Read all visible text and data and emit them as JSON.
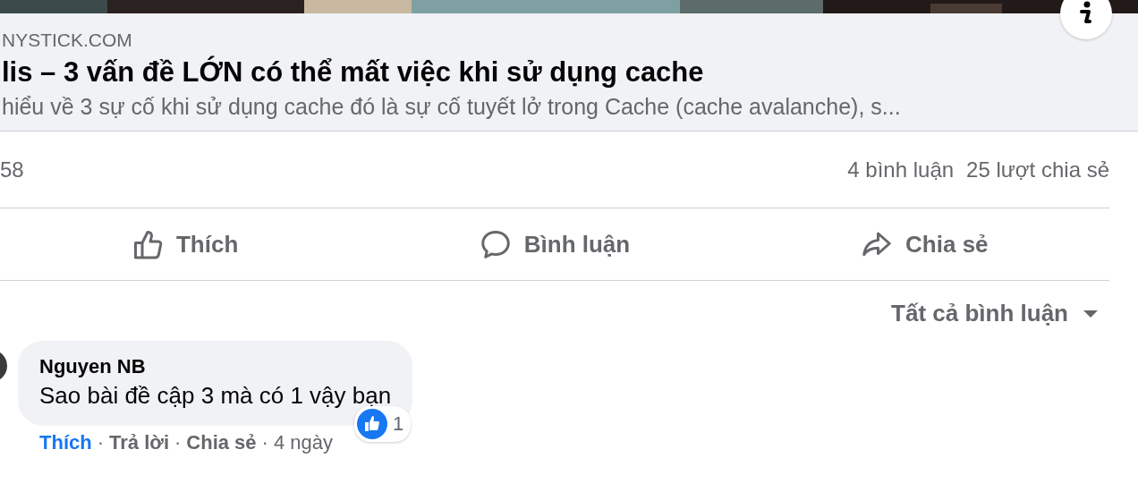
{
  "link_preview": {
    "domain": "NYSTICK.COM",
    "title": "lis – 3 vấn đề LỚN có thể mất việc khi sử dụng cache",
    "description": "hiểu về 3 sự cố khi sử dụng cache đó là sự cố tuyết lở trong Cache (cache avalanche), s..."
  },
  "stats": {
    "reactions": "58",
    "comments": "4 bình luận",
    "shares": "25 lượt chia sẻ"
  },
  "actions": [
    {
      "kind": "like",
      "label": "Thích"
    },
    {
      "kind": "comment",
      "label": "Bình luận"
    },
    {
      "kind": "share",
      "label": "Chia sẻ"
    }
  ],
  "sort": {
    "label": "Tất cả bình luận"
  },
  "comments": [
    {
      "author": "Nguyen NB",
      "text": "Sao bài đề cập 3 mà có 1 vậy bạn",
      "liked": true,
      "like_label": "Thích",
      "reply_label": "Trả lời",
      "share_label": "Chia sẻ",
      "time": "4 ngày",
      "separator": "·",
      "reaction_count": "1"
    }
  ]
}
